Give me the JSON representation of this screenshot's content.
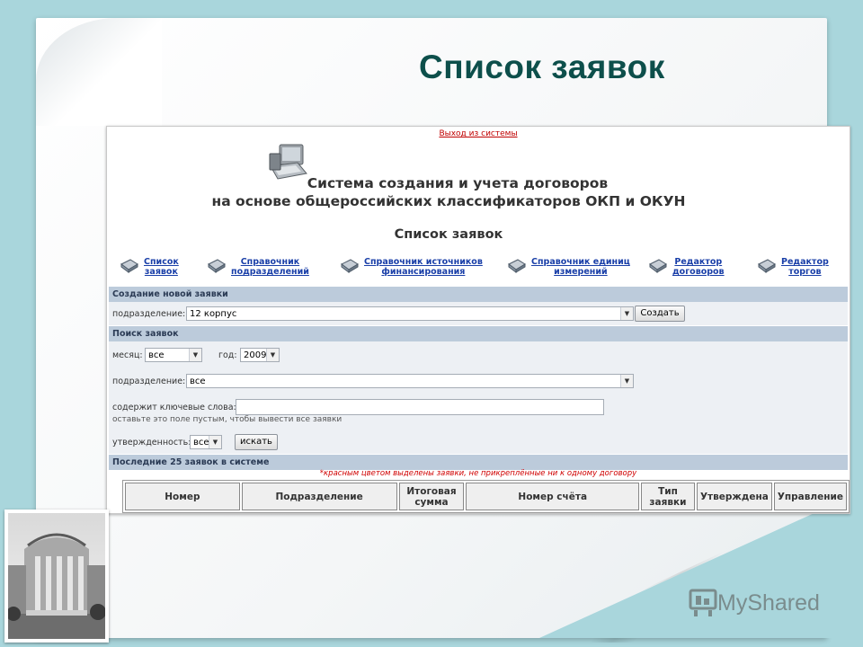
{
  "slide": {
    "title": "Список заявок"
  },
  "app": {
    "logout_link": "Выход из системы",
    "title_line1": "Система создания и учета договоров",
    "title_line2": "на основе общероссийских классификаторов ОКП и ОКУН",
    "page_heading": "Список заявок"
  },
  "nav": {
    "items": [
      {
        "line1": "Список",
        "line2": "заявок"
      },
      {
        "line1": "Справочник",
        "line2": "подразделений"
      },
      {
        "line1": "Справочник источников",
        "line2": "финансирования"
      },
      {
        "line1": "Справочник единиц",
        "line2": "измерений"
      },
      {
        "line1": "Редактор",
        "line2": "договоров"
      },
      {
        "line1": "Редактор",
        "line2": "торгов"
      }
    ]
  },
  "create_section": {
    "header": "Создание новой заявки",
    "division_label": "подразделение:",
    "division_value": "12 корпус",
    "create_button": "Создать"
  },
  "search_section": {
    "header": "Поиск заявок",
    "month_label": "месяц:",
    "month_value": "все",
    "year_label": "год:",
    "year_value": "2009",
    "division_label": "подразделение:",
    "division_value": "все",
    "keywords_label": "содержит ключевые слова:",
    "keywords_value": "",
    "keywords_hint": "оставьте это поле пустым, чтобы вывести все заявки",
    "approval_label": "утвержденность:",
    "approval_value": "все",
    "search_button": "искать"
  },
  "recent_section": {
    "header": "Последние 25 заявок в системе",
    "note": "*красным цветом выделены заявки, не прикреплённые ни к одному договору",
    "columns": [
      "Номер",
      "Подразделение",
      "Итоговая сумма",
      "Номер счёта",
      "Тип заявки",
      "Утверждена",
      "Управление"
    ]
  },
  "branding": {
    "text": "MyShared"
  },
  "colors": {
    "background": "#a9d6dc",
    "title": "#0d4f4b",
    "section_bar": "#bccbdb",
    "link": "#1a3fa8",
    "logout": "#c00000"
  },
  "icons": [
    "book-icon",
    "computer-logo-icon",
    "dropdown-arrow-icon",
    "myshared-logo-icon"
  ]
}
